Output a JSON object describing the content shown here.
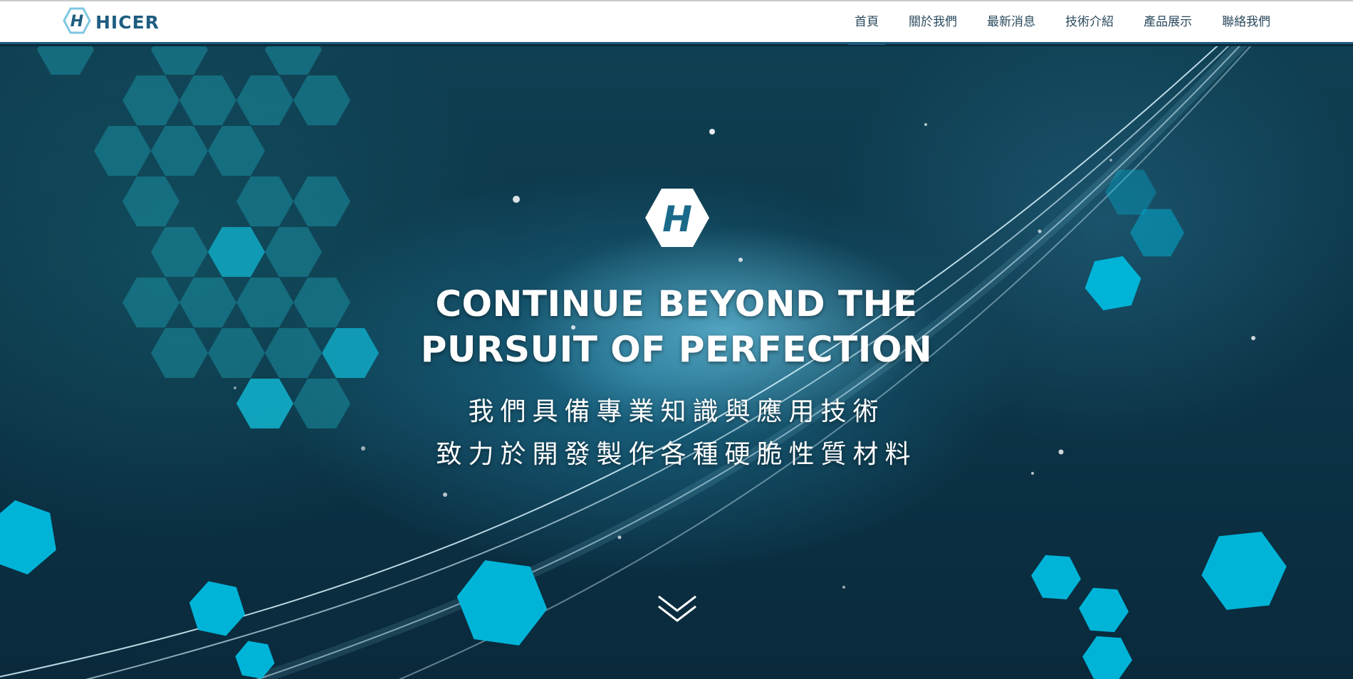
{
  "brand": {
    "name": "HICER",
    "color": "#1e5d80"
  },
  "nav": {
    "items": [
      {
        "label": "首頁",
        "active": true
      },
      {
        "label": "關於我們"
      },
      {
        "label": "最新消息"
      },
      {
        "label": "技術介紹"
      },
      {
        "label": "產品展示"
      },
      {
        "label": "聯絡我們"
      }
    ]
  },
  "hero": {
    "title_line1": "CONTINUE BEYOND THE",
    "title_line2": "PURSUIT OF PERFECTION",
    "subtitle_line1": "我們具備專業知識與應用技術",
    "subtitle_line2": "致力於開發製作各種硬脆性質材料",
    "logo_icon": "hexagon-h-logo-icon",
    "scroll_icon": "double-chevron-down-icon",
    "hex_color": "#00b4d8"
  }
}
